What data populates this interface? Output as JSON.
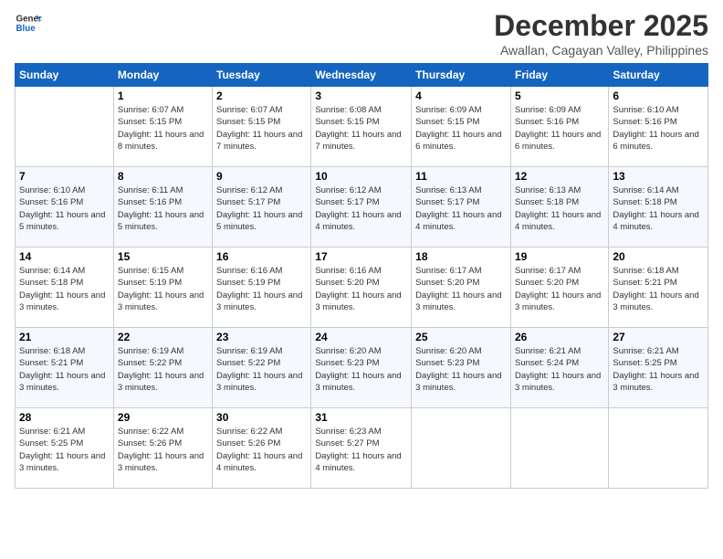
{
  "logo": {
    "line1": "General",
    "line2": "Blue"
  },
  "title": "December 2025",
  "subtitle": "Awallan, Cagayan Valley, Philippines",
  "days_of_week": [
    "Sunday",
    "Monday",
    "Tuesday",
    "Wednesday",
    "Thursday",
    "Friday",
    "Saturday"
  ],
  "weeks": [
    [
      {
        "day": "",
        "info": ""
      },
      {
        "day": "1",
        "info": "Sunrise: 6:07 AM\nSunset: 5:15 PM\nDaylight: 11 hours\nand 8 minutes."
      },
      {
        "day": "2",
        "info": "Sunrise: 6:07 AM\nSunset: 5:15 PM\nDaylight: 11 hours\nand 7 minutes."
      },
      {
        "day": "3",
        "info": "Sunrise: 6:08 AM\nSunset: 5:15 PM\nDaylight: 11 hours\nand 7 minutes."
      },
      {
        "day": "4",
        "info": "Sunrise: 6:09 AM\nSunset: 5:15 PM\nDaylight: 11 hours\nand 6 minutes."
      },
      {
        "day": "5",
        "info": "Sunrise: 6:09 AM\nSunset: 5:16 PM\nDaylight: 11 hours\nand 6 minutes."
      },
      {
        "day": "6",
        "info": "Sunrise: 6:10 AM\nSunset: 5:16 PM\nDaylight: 11 hours\nand 6 minutes."
      }
    ],
    [
      {
        "day": "7",
        "info": "Sunrise: 6:10 AM\nSunset: 5:16 PM\nDaylight: 11 hours\nand 5 minutes."
      },
      {
        "day": "8",
        "info": "Sunrise: 6:11 AM\nSunset: 5:16 PM\nDaylight: 11 hours\nand 5 minutes."
      },
      {
        "day": "9",
        "info": "Sunrise: 6:12 AM\nSunset: 5:17 PM\nDaylight: 11 hours\nand 5 minutes."
      },
      {
        "day": "10",
        "info": "Sunrise: 6:12 AM\nSunset: 5:17 PM\nDaylight: 11 hours\nand 4 minutes."
      },
      {
        "day": "11",
        "info": "Sunrise: 6:13 AM\nSunset: 5:17 PM\nDaylight: 11 hours\nand 4 minutes."
      },
      {
        "day": "12",
        "info": "Sunrise: 6:13 AM\nSunset: 5:18 PM\nDaylight: 11 hours\nand 4 minutes."
      },
      {
        "day": "13",
        "info": "Sunrise: 6:14 AM\nSunset: 5:18 PM\nDaylight: 11 hours\nand 4 minutes."
      }
    ],
    [
      {
        "day": "14",
        "info": "Sunrise: 6:14 AM\nSunset: 5:18 PM\nDaylight: 11 hours\nand 3 minutes."
      },
      {
        "day": "15",
        "info": "Sunrise: 6:15 AM\nSunset: 5:19 PM\nDaylight: 11 hours\nand 3 minutes."
      },
      {
        "day": "16",
        "info": "Sunrise: 6:16 AM\nSunset: 5:19 PM\nDaylight: 11 hours\nand 3 minutes."
      },
      {
        "day": "17",
        "info": "Sunrise: 6:16 AM\nSunset: 5:20 PM\nDaylight: 11 hours\nand 3 minutes."
      },
      {
        "day": "18",
        "info": "Sunrise: 6:17 AM\nSunset: 5:20 PM\nDaylight: 11 hours\nand 3 minutes."
      },
      {
        "day": "19",
        "info": "Sunrise: 6:17 AM\nSunset: 5:20 PM\nDaylight: 11 hours\nand 3 minutes."
      },
      {
        "day": "20",
        "info": "Sunrise: 6:18 AM\nSunset: 5:21 PM\nDaylight: 11 hours\nand 3 minutes."
      }
    ],
    [
      {
        "day": "21",
        "info": "Sunrise: 6:18 AM\nSunset: 5:21 PM\nDaylight: 11 hours\nand 3 minutes."
      },
      {
        "day": "22",
        "info": "Sunrise: 6:19 AM\nSunset: 5:22 PM\nDaylight: 11 hours\nand 3 minutes."
      },
      {
        "day": "23",
        "info": "Sunrise: 6:19 AM\nSunset: 5:22 PM\nDaylight: 11 hours\nand 3 minutes."
      },
      {
        "day": "24",
        "info": "Sunrise: 6:20 AM\nSunset: 5:23 PM\nDaylight: 11 hours\nand 3 minutes."
      },
      {
        "day": "25",
        "info": "Sunrise: 6:20 AM\nSunset: 5:23 PM\nDaylight: 11 hours\nand 3 minutes."
      },
      {
        "day": "26",
        "info": "Sunrise: 6:21 AM\nSunset: 5:24 PM\nDaylight: 11 hours\nand 3 minutes."
      },
      {
        "day": "27",
        "info": "Sunrise: 6:21 AM\nSunset: 5:25 PM\nDaylight: 11 hours\nand 3 minutes."
      }
    ],
    [
      {
        "day": "28",
        "info": "Sunrise: 6:21 AM\nSunset: 5:25 PM\nDaylight: 11 hours\nand 3 minutes."
      },
      {
        "day": "29",
        "info": "Sunrise: 6:22 AM\nSunset: 5:26 PM\nDaylight: 11 hours\nand 3 minutes."
      },
      {
        "day": "30",
        "info": "Sunrise: 6:22 AM\nSunset: 5:26 PM\nDaylight: 11 hours\nand 4 minutes."
      },
      {
        "day": "31",
        "info": "Sunrise: 6:23 AM\nSunset: 5:27 PM\nDaylight: 11 hours\nand 4 minutes."
      },
      {
        "day": "",
        "info": ""
      },
      {
        "day": "",
        "info": ""
      },
      {
        "day": "",
        "info": ""
      }
    ]
  ]
}
